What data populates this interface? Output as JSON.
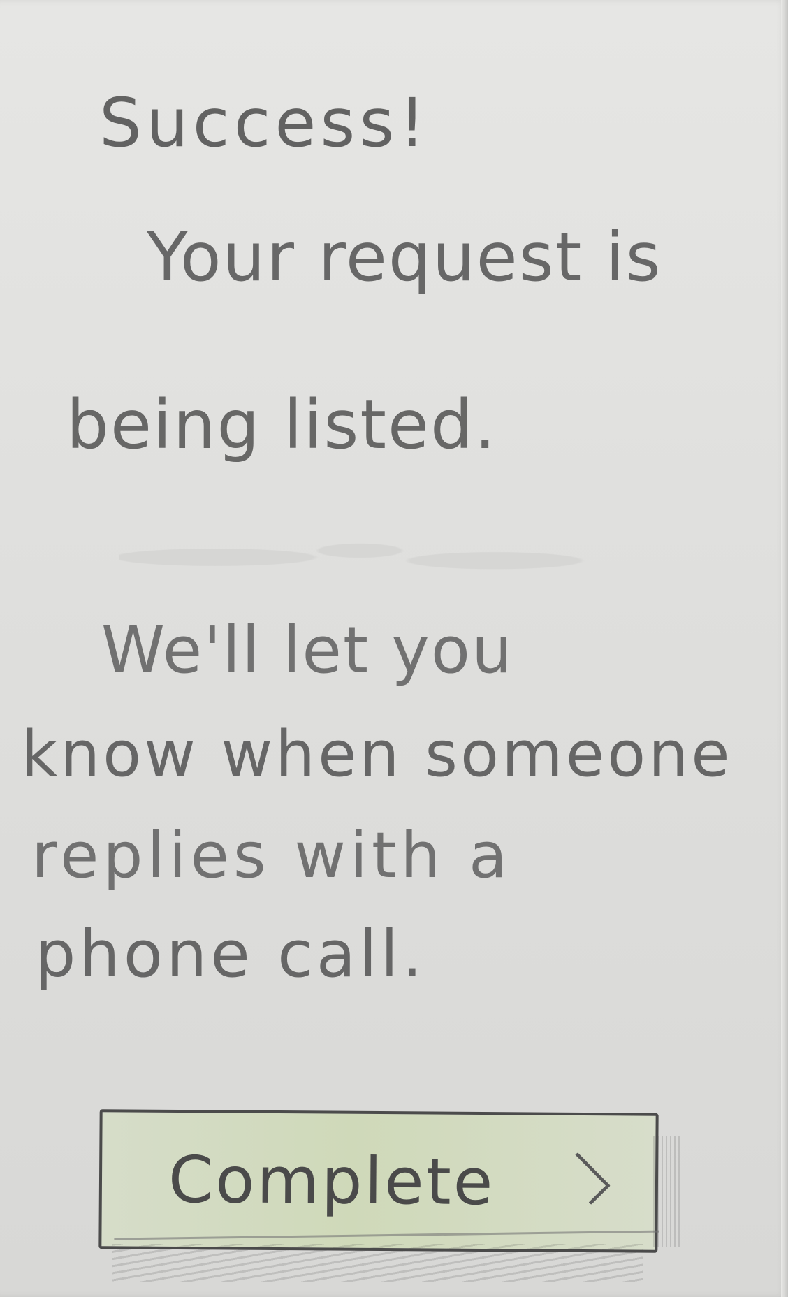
{
  "screen": {
    "heading": "Success!",
    "message_lines": [
      "Your request is",
      "being listed.",
      "We'll let you",
      "know when someone",
      "replies with a",
      "phone call."
    ]
  },
  "actions": {
    "complete_label": "Complete",
    "complete_icon": "chevron-right-icon"
  }
}
